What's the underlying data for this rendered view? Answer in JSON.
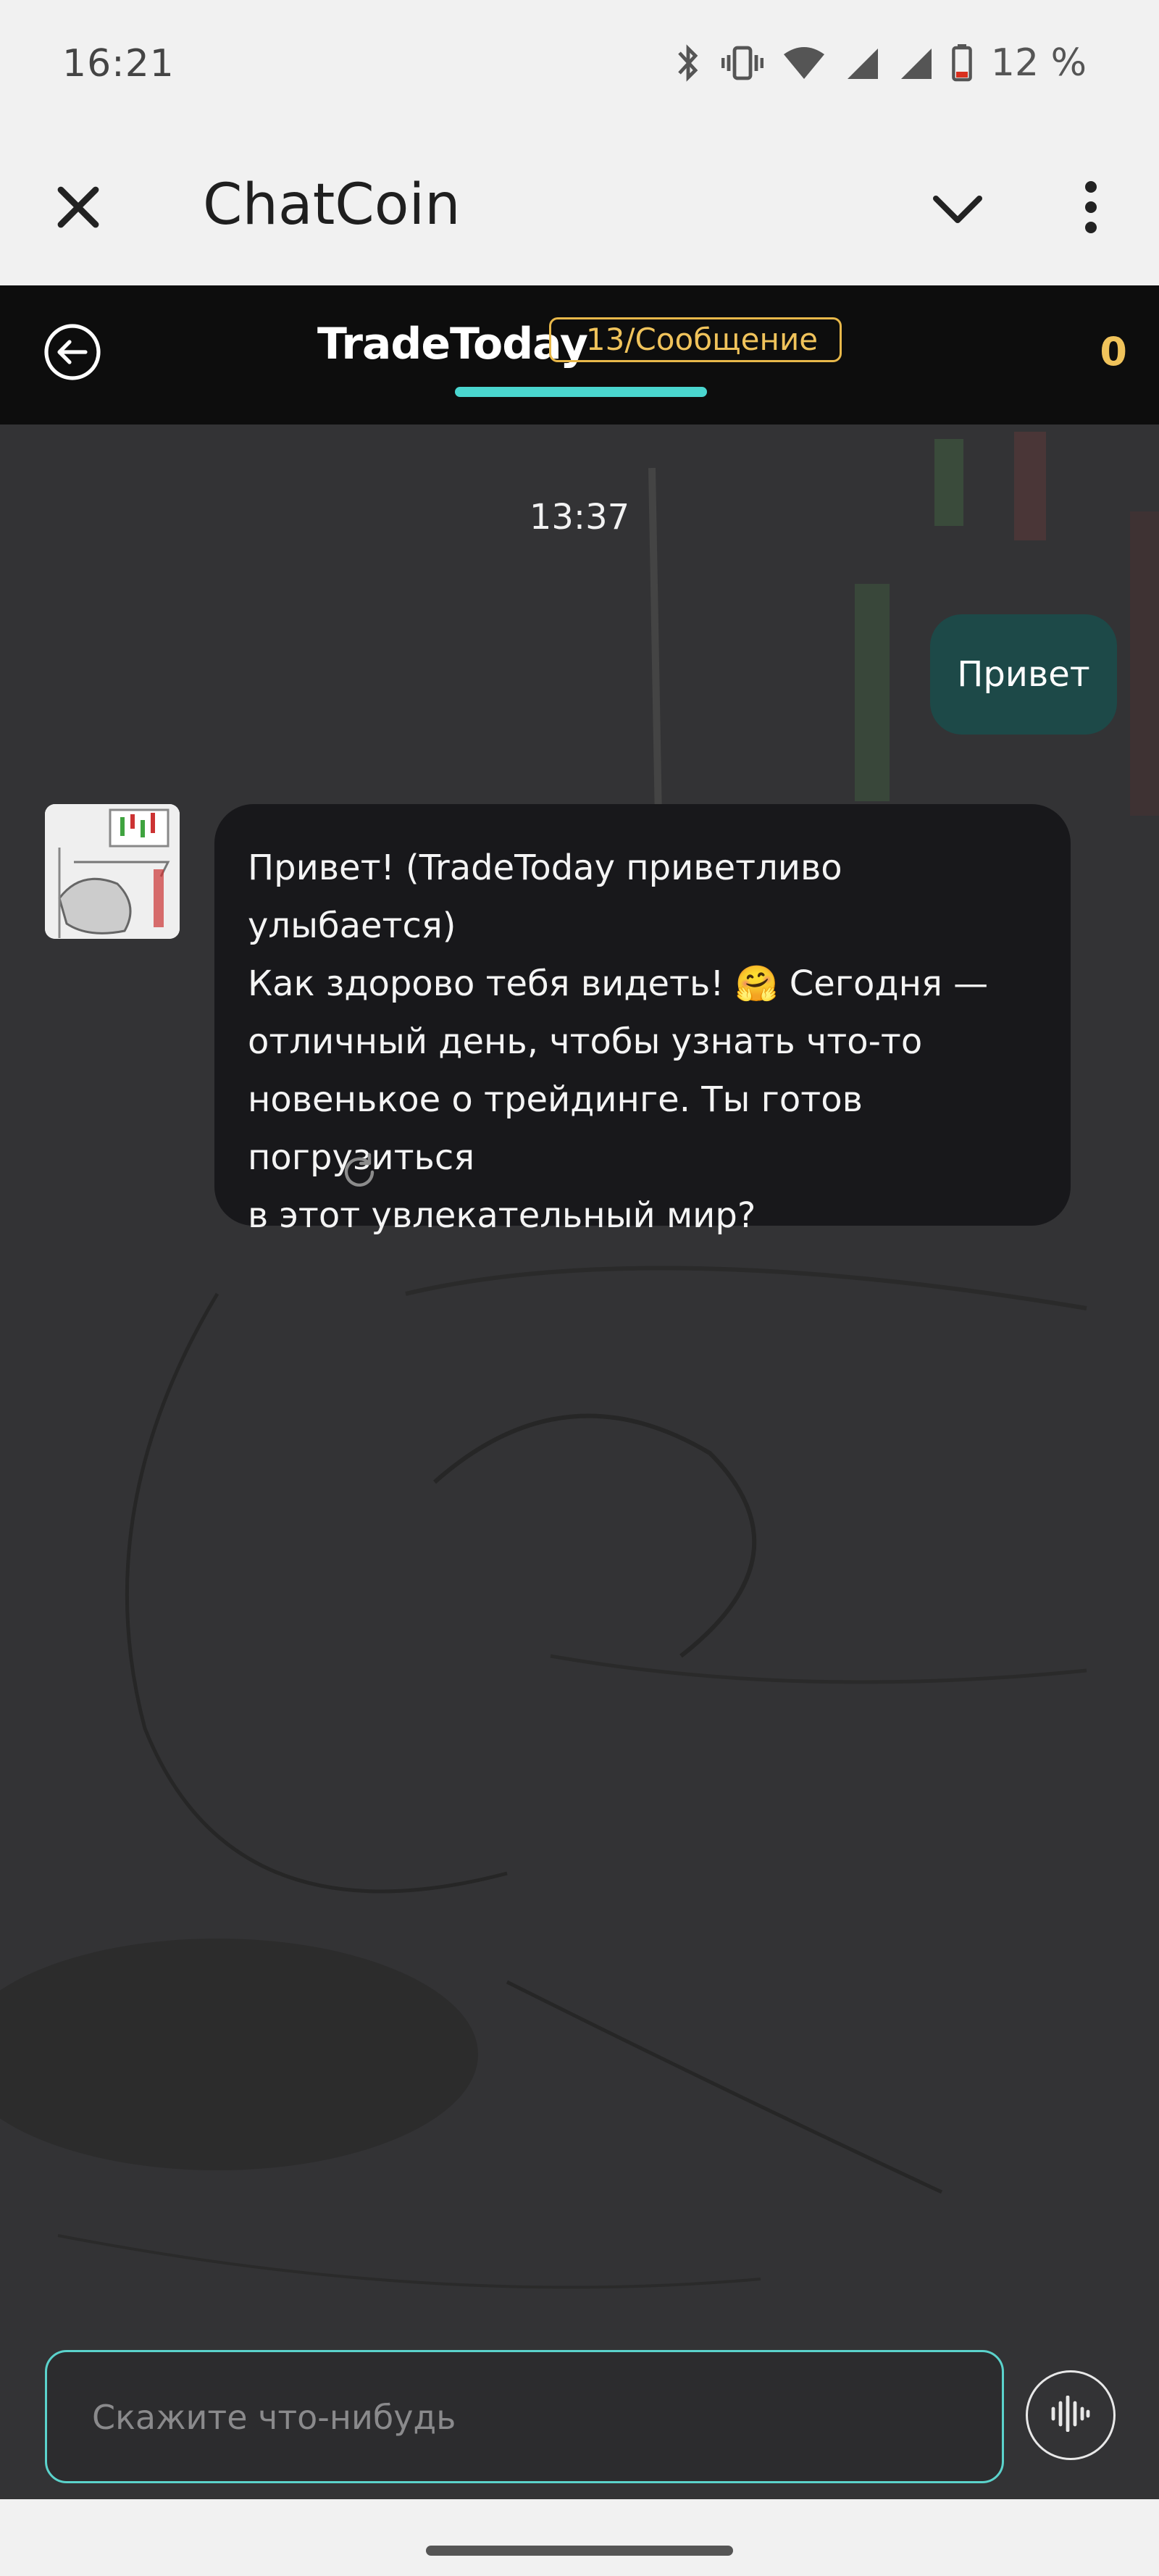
{
  "status_bar": {
    "time": "16:21",
    "battery_percent": "12 %",
    "icons": [
      "bluetooth-icon",
      "vibrate-icon",
      "wifi-icon",
      "signal-icon",
      "signal-icon",
      "battery-icon"
    ]
  },
  "app_bar": {
    "title": "ChatCoin",
    "icons": [
      "close-icon",
      "chevron-down-icon",
      "more-vert-icon"
    ]
  },
  "chat_header": {
    "bot_name": "TradeToday",
    "price_badge": "13/Сообщение",
    "coin_balance": "0",
    "accent_color": "#4ad6cf",
    "coin_color": "#f0c35b"
  },
  "conversation": {
    "timestamp": "13:37",
    "user_message": "Привет",
    "bot_message": "Привет! (TradeToday приветливо улыбается)\nКак здорово тебя видеть! 🤗 Сегодня —\nотличный день, чтобы узнать что-то\nновенькое о трейдинге. Ты готов погрузиться\nв этот увлекательный мир?"
  },
  "composer": {
    "placeholder": "Скажите что-нибудь"
  }
}
